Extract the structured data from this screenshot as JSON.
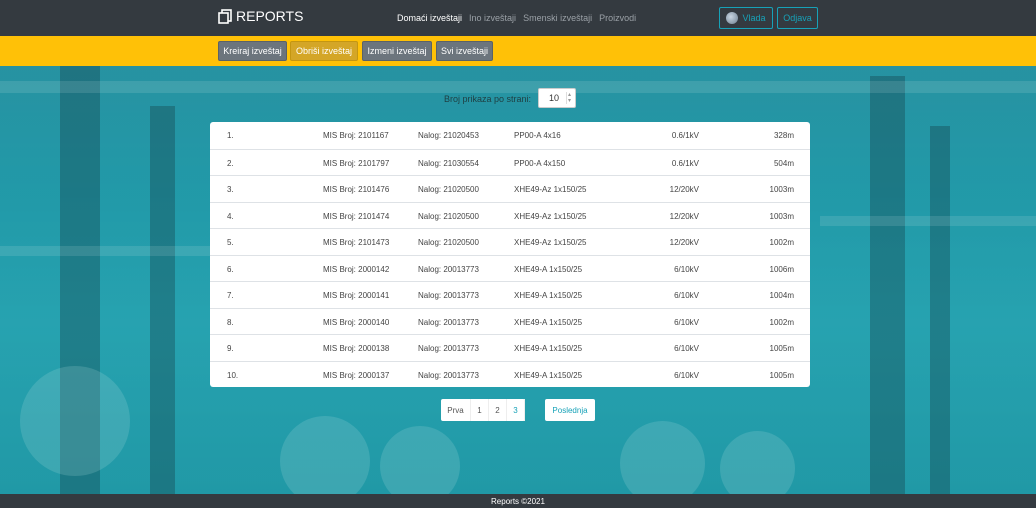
{
  "app": {
    "brand": "REPORTS",
    "brand_icon": "copy-icon"
  },
  "nav": {
    "links": [
      "Domaći izveštaji",
      "Ino izveštaji",
      "Smenski izveštaji",
      "Proizvodi"
    ],
    "active_index": 0,
    "user_label": "Vlada",
    "logout_label": "Odjava"
  },
  "subnav": {
    "buttons": [
      "Kreiraj izveštaj",
      "Obriši izveštaj",
      "Izmeni izveštaj",
      "Svi izveštaji"
    ],
    "active_index": 1
  },
  "per_page": {
    "label": "Broj prikaza po strani:",
    "value": "10"
  },
  "table": {
    "rows": [
      {
        "num": "1.",
        "mis": "MIS Broj: 2101167",
        "nalog": "Nalog: 21020453",
        "cable": "PP00-A 4x16",
        "volt": "0.6/1kV",
        "len": "328m"
      },
      {
        "num": "2.",
        "mis": "MIS Broj: 2101797",
        "nalog": "Nalog: 21030554",
        "cable": "PP00-A 4x150",
        "volt": "0.6/1kV",
        "len": "504m"
      },
      {
        "num": "3.",
        "mis": "MIS Broj: 2101476",
        "nalog": "Nalog: 21020500",
        "cable": "XHE49-Az 1x150/25",
        "volt": "12/20kV",
        "len": "1003m"
      },
      {
        "num": "4.",
        "mis": "MIS Broj: 2101474",
        "nalog": "Nalog: 21020500",
        "cable": "XHE49-Az 1x150/25",
        "volt": "12/20kV",
        "len": "1003m"
      },
      {
        "num": "5.",
        "mis": "MIS Broj: 2101473",
        "nalog": "Nalog: 21020500",
        "cable": "XHE49-Az 1x150/25",
        "volt": "12/20kV",
        "len": "1002m"
      },
      {
        "num": "6.",
        "mis": "MIS Broj: 2000142",
        "nalog": "Nalog: 20013773",
        "cable": "XHE49-A 1x150/25",
        "volt": "6/10kV",
        "len": "1006m"
      },
      {
        "num": "7.",
        "mis": "MIS Broj: 2000141",
        "nalog": "Nalog: 20013773",
        "cable": "XHE49-A 1x150/25",
        "volt": "6/10kV",
        "len": "1004m"
      },
      {
        "num": "8.",
        "mis": "MIS Broj: 2000140",
        "nalog": "Nalog: 20013773",
        "cable": "XHE49-A 1x150/25",
        "volt": "6/10kV",
        "len": "1002m"
      },
      {
        "num": "9.",
        "mis": "MIS Broj: 2000138",
        "nalog": "Nalog: 20013773",
        "cable": "XHE49-A 1x150/25",
        "volt": "6/10kV",
        "len": "1005m"
      },
      {
        "num": "10.",
        "mis": "MIS Broj: 2000137",
        "nalog": "Nalog: 20013773",
        "cable": "XHE49-A 1x150/25",
        "volt": "6/10kV",
        "len": "1005m"
      }
    ]
  },
  "pagination": {
    "first_label": "Prva",
    "pages": [
      "1",
      "2",
      "3"
    ],
    "current_index": 2,
    "last_label": "Poslednja"
  },
  "footer": {
    "text": "Reports ©2021"
  },
  "colors": {
    "navbar": "#343a40",
    "subnav": "#ffc107",
    "accent": "#17a2b8",
    "button": "#6c757d",
    "active_button": "#d4a627"
  }
}
